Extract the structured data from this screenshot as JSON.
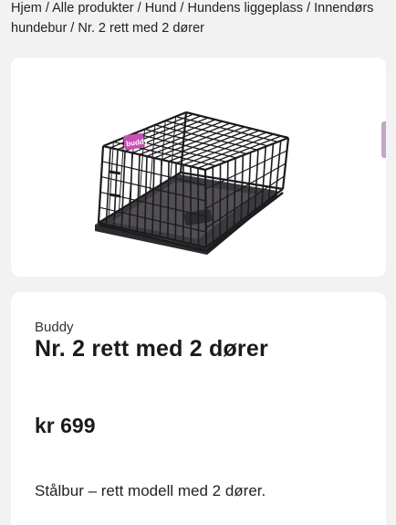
{
  "breadcrumb": {
    "items": [
      "Hjem",
      "Alle produkter",
      "Hund",
      "Hundens liggeplass",
      "Innendørs hundebur",
      "Nr. 2 rett med 2 dører"
    ],
    "separator": " / "
  },
  "product": {
    "image_icon": "dog-crate-image",
    "logo_text": "buddy",
    "brand": "Buddy",
    "title": "Nr. 2 rett med 2 dører",
    "price": "kr 699",
    "description": "Stålbur – rett modell med 2 dører."
  },
  "colors": {
    "background": "#f2f2f2",
    "card": "#ffffff",
    "text": "#1a1a1a",
    "logo": "#c64fb5"
  }
}
